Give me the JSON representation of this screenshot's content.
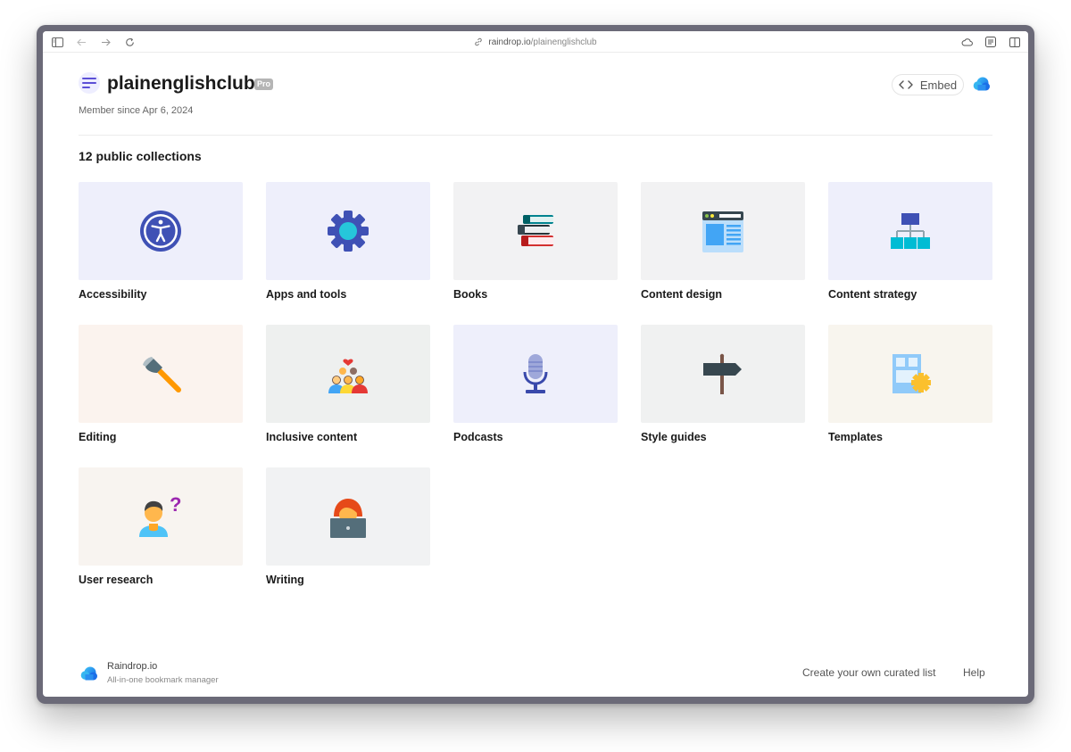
{
  "browser": {
    "url_host": "raindrop.io",
    "url_path": "/plainenglishclub"
  },
  "profile": {
    "name": "plainenglishclub",
    "badge": "Pro",
    "member_since": "Member since Apr 6, 2024"
  },
  "header": {
    "embed_label": "Embed"
  },
  "collections": {
    "title": "12 public collections",
    "items": [
      {
        "label": "Accessibility",
        "icon": "accessibility-icon",
        "bg": "#eeeffb"
      },
      {
        "label": "Apps and tools",
        "icon": "gear-icon",
        "bg": "#eeeffb"
      },
      {
        "label": "Books",
        "icon": "books-icon",
        "bg": "#f2f2f3"
      },
      {
        "label": "Content design",
        "icon": "browser-window-icon",
        "bg": "#f2f2f3"
      },
      {
        "label": "Content strategy",
        "icon": "org-chart-icon",
        "bg": "#eeeffb"
      },
      {
        "label": "Editing",
        "icon": "axe-icon",
        "bg": "#fbf3ee"
      },
      {
        "label": "Inclusive content",
        "icon": "people-group-icon",
        "bg": "#eef0ef"
      },
      {
        "label": "Podcasts",
        "icon": "microphone-icon",
        "bg": "#eeeffb"
      },
      {
        "label": "Style guides",
        "icon": "signpost-icon",
        "bg": "#f0f1f1"
      },
      {
        "label": "Templates",
        "icon": "template-gear-icon",
        "bg": "#f8f5ee"
      },
      {
        "label": "User research",
        "icon": "person-question-icon",
        "bg": "#f8f4f0"
      },
      {
        "label": "Writing",
        "icon": "person-laptop-icon",
        "bg": "#f1f2f3"
      }
    ]
  },
  "footer": {
    "brand": "Raindrop.io",
    "tagline": "All-in-one bookmark manager",
    "links": [
      "Create your own curated list",
      "Help"
    ]
  }
}
